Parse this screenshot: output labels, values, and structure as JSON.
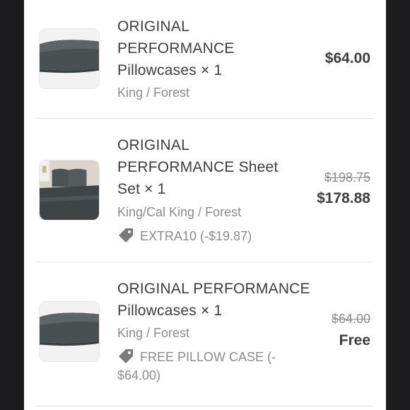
{
  "items": [
    {
      "title_lines": [
        "ORIGINAL",
        "PERFORMANCE",
        "Pillowcases × 1"
      ],
      "variant": "King / Forest",
      "price": "$64.00",
      "image": "pillowcase-image"
    },
    {
      "title_lines": [
        "ORIGINAL",
        "PERFORMANCE Sheet",
        "Set × 1"
      ],
      "variant": "King/Cal King / Forest",
      "discount_code": "EXTRA10 (-$19.87)",
      "original_price": "$198.75",
      "price": "$178.88",
      "image": "sheet-set-image"
    },
    {
      "title_lines": [
        "ORIGINAL PERFORMANCE",
        "Pillowcases × 1"
      ],
      "variant": "King / Forest",
      "discount_lines": [
        "FREE PILLOW CASE (-",
        "$64.00)"
      ],
      "original_price": "$64.00",
      "price": "Free",
      "image": "pillowcase-image"
    }
  ],
  "colors": {
    "text": "#3d3d3d",
    "muted": "#8b8b8b",
    "divider": "#e2e2e2",
    "background": "#1c1c1e"
  },
  "icons": {
    "discount": "tag-icon"
  }
}
